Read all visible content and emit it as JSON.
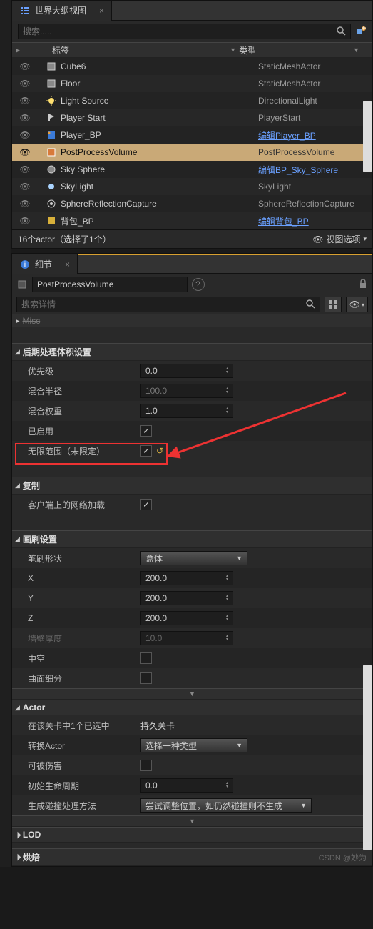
{
  "outliner": {
    "title": "世界大纲视图",
    "searchPlaceholder": "搜索.....",
    "colLabel": "标签",
    "colType": "类型",
    "rows": [
      {
        "label": "Cube6",
        "type": "StaticMeshActor",
        "link": false
      },
      {
        "label": "Floor",
        "type": "StaticMeshActor",
        "link": false
      },
      {
        "label": "Light Source",
        "type": "DirectionalLight",
        "link": false
      },
      {
        "label": "Player Start",
        "type": "PlayerStart",
        "link": false
      },
      {
        "label": "Player_BP",
        "type": "编辑Player_BP",
        "link": true
      },
      {
        "label": "PostProcessVolume",
        "type": "PostProcessVolume",
        "link": false
      },
      {
        "label": "Sky Sphere",
        "type": "编辑BP_Sky_Sphere",
        "link": true
      },
      {
        "label": "SkyLight",
        "type": "SkyLight",
        "link": false
      },
      {
        "label": "SphereReflectionCapture",
        "type": "SphereReflectionCapture",
        "link": false
      },
      {
        "label": "背包_BP",
        "type": "编辑背包_BP",
        "link": true
      }
    ],
    "footer": "16个actor（选择了1个）",
    "viewOptions": "视图选项"
  },
  "details": {
    "title": "细节",
    "actorName": "PostProcessVolume",
    "searchPlaceholder": "搜索详情",
    "miscLabel": "Misc",
    "sections": {
      "postProcess": {
        "title": "后期处理体积设置",
        "priority": {
          "label": "优先级",
          "value": "0.0"
        },
        "blendRadius": {
          "label": "混合半径",
          "value": "100.0"
        },
        "blendWeight": {
          "label": "混合权重",
          "value": "1.0"
        },
        "enabled": {
          "label": "已启用"
        },
        "unbound": {
          "label": "无限范围（未限定）"
        }
      },
      "replication": {
        "title": "复制",
        "netLoad": {
          "label": "客户端上的网络加载"
        }
      },
      "brush": {
        "title": "画刷设置",
        "shape": {
          "label": "笔刷形状",
          "value": "盒体"
        },
        "x": {
          "label": "X",
          "value": "200.0"
        },
        "y": {
          "label": "Y",
          "value": "200.0"
        },
        "z": {
          "label": "Z",
          "value": "200.0"
        },
        "wall": {
          "label": "墙壁厚度",
          "value": "10.0"
        },
        "hollow": {
          "label": "中空"
        },
        "tess": {
          "label": "曲面细分"
        }
      },
      "actor": {
        "title": "Actor",
        "selected": {
          "label": "在该关卡中1个已选中",
          "value": "持久关卡"
        },
        "convert": {
          "label": "转换Actor",
          "value": "选择一种类型"
        },
        "damage": {
          "label": "可被伤害"
        },
        "lifespan": {
          "label": "初始生命周期",
          "value": "0.0"
        },
        "spawn": {
          "label": "生成碰撞处理方法",
          "value": "尝试调整位置，如仍然碰撞则不生成"
        }
      },
      "lod": {
        "title": "LOD"
      },
      "bake": {
        "title": "烘焙"
      }
    }
  },
  "watermark": "CSDN @妙为"
}
